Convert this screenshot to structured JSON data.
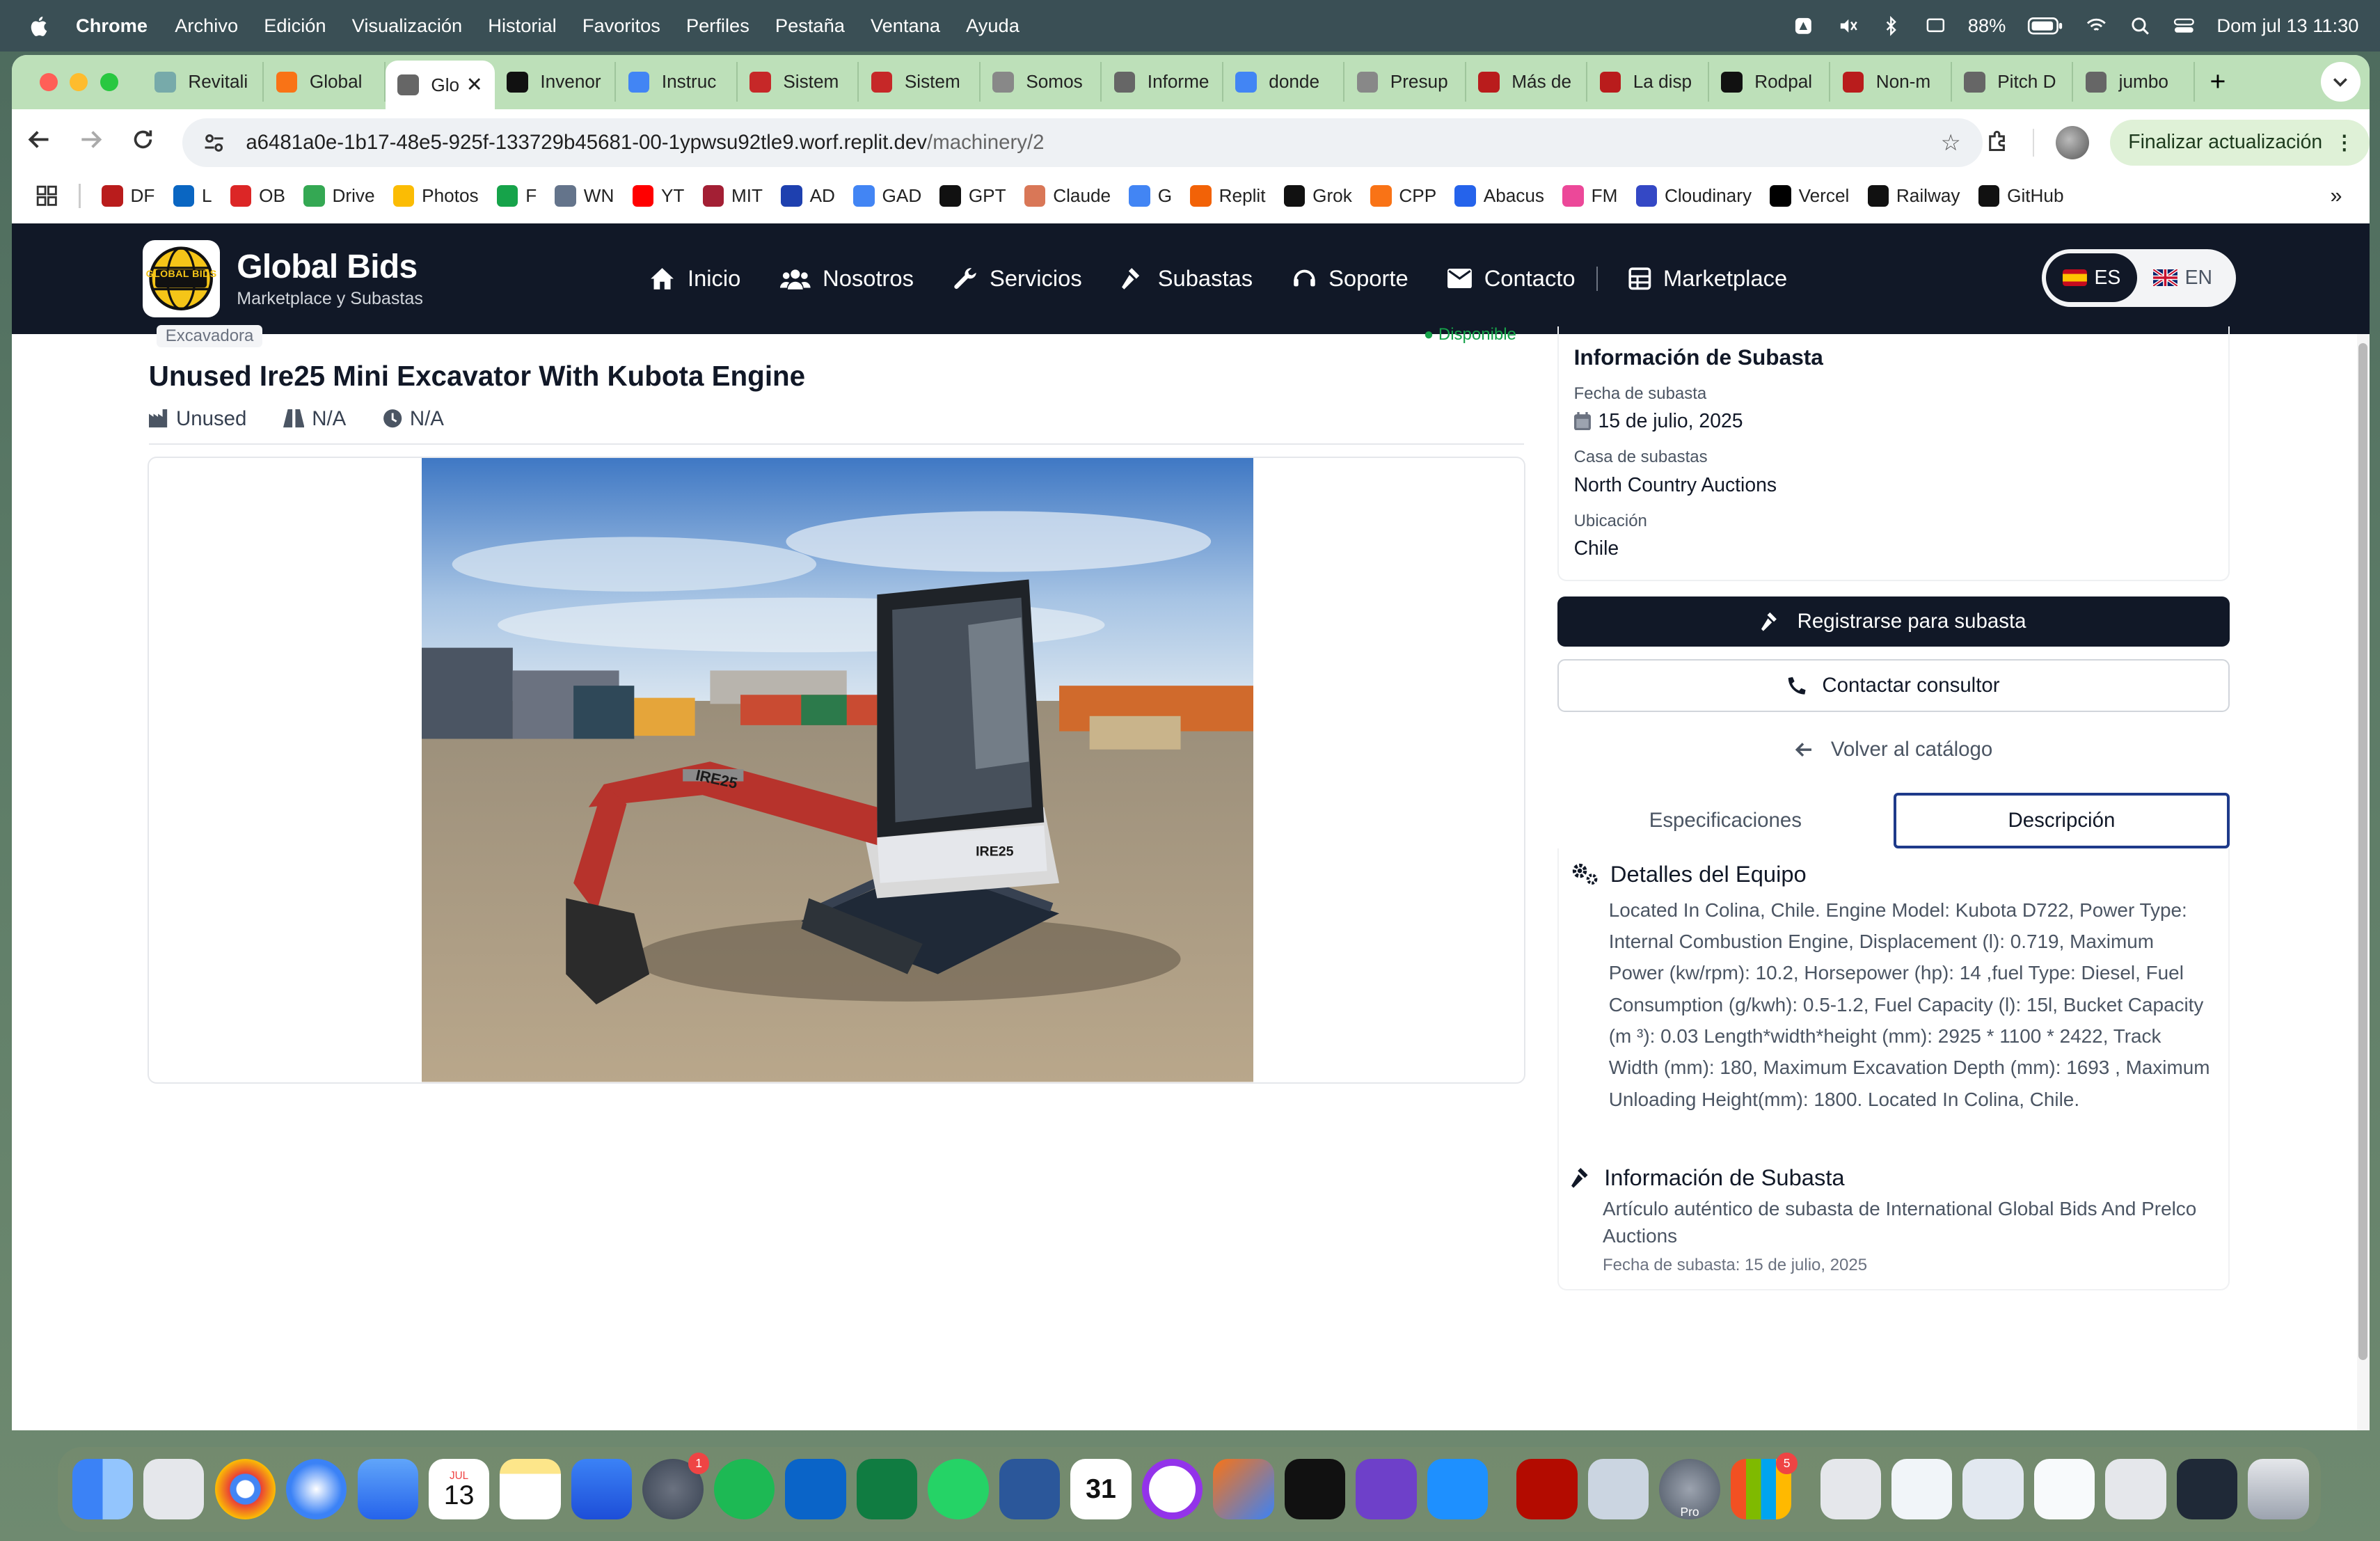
{
  "menubar": {
    "app": "Chrome",
    "items": [
      "Archivo",
      "Edición",
      "Visualización",
      "Historial",
      "Favoritos",
      "Perfiles",
      "Pestaña",
      "Ventana",
      "Ayuda"
    ],
    "battery": "88%",
    "datetime": "Dom jul 13  11:30"
  },
  "tabs": [
    {
      "label": "Revitali",
      "color": "#7aa"
    },
    {
      "label": "Global",
      "color": "#f97316"
    },
    {
      "label": "Glo",
      "color": "#666",
      "active": true
    },
    {
      "label": "Invenor",
      "color": "#111"
    },
    {
      "label": "Instruc",
      "color": "#4285f4"
    },
    {
      "label": "Sistem",
      "color": "#c62828"
    },
    {
      "label": "Sistem",
      "color": "#c62828"
    },
    {
      "label": "Somos",
      "color": "#888"
    },
    {
      "label": "Informe",
      "color": "#666"
    },
    {
      "label": "donde",
      "color": "#4285f4"
    },
    {
      "label": "Presup",
      "color": "#888"
    },
    {
      "label": "Más de",
      "color": "#b91c1c"
    },
    {
      "label": "La disp",
      "color": "#b91c1c"
    },
    {
      "label": "Rodpal",
      "color": "#111"
    },
    {
      "label": "Non-m",
      "color": "#b91c1c"
    },
    {
      "label": "Pitch D",
      "color": "#666"
    },
    {
      "label": "jumbo",
      "color": "#666"
    }
  ],
  "address": {
    "host": "a6481a0e-1b17-48e5-925f-133729b45681-00-1ypwsu92tle9.worf.replit.dev",
    "path": "/machinery/2"
  },
  "update_button": "Finalizar actualización",
  "bookmarks": [
    {
      "label": "DF",
      "color": "#b91c1c"
    },
    {
      "label": "L",
      "color": "#0a66c2"
    },
    {
      "label": "OB",
      "color": "#dc2626"
    },
    {
      "label": "Drive",
      "color": "#34a853"
    },
    {
      "label": "Photos",
      "color": "#fbbc04"
    },
    {
      "label": "F",
      "color": "#16a34a"
    },
    {
      "label": "WN",
      "color": "#64748b"
    },
    {
      "label": "YT",
      "color": "#ff0000"
    },
    {
      "label": "MIT",
      "color": "#a31f34"
    },
    {
      "label": "AD",
      "color": "#1e40af"
    },
    {
      "label": "GAD",
      "color": "#4285f4"
    },
    {
      "label": "GPT",
      "color": "#111"
    },
    {
      "label": "Claude",
      "color": "#d97757"
    },
    {
      "label": "G",
      "color": "#4285f4"
    },
    {
      "label": "Replit",
      "color": "#f26207"
    },
    {
      "label": "Grok",
      "color": "#111"
    },
    {
      "label": "CPP",
      "color": "#f97316"
    },
    {
      "label": "Abacus",
      "color": "#2563eb"
    },
    {
      "label": "FM",
      "color": "#ec4899"
    },
    {
      "label": "Cloudinary",
      "color": "#3448c5"
    },
    {
      "label": "Vercel",
      "color": "#000"
    },
    {
      "label": "Railway",
      "color": "#111"
    },
    {
      "label": "GitHub",
      "color": "#111"
    }
  ],
  "site": {
    "brand": "Global Bids",
    "tagline": "Marketplace y Subastas",
    "logo_text": "GLOBAL BIDS",
    "nav": [
      "Inicio",
      "Nosotros",
      "Servicios",
      "Subastas",
      "Soporte",
      "Contacto",
      "Marketplace"
    ],
    "lang_es": "ES",
    "lang_en": "EN"
  },
  "product": {
    "category": "Excavadora",
    "availability": "Disponible",
    "title": "Unused Ire25 Mini Excavator With Kubota Engine",
    "condition": "Unused",
    "hours": "N/A",
    "year": "N/A",
    "machine_label": "IRE25"
  },
  "auction": {
    "heading": "Información de Subasta",
    "date_label": "Fecha de subasta",
    "date": "15 de julio, 2025",
    "house_label": "Casa de subastas",
    "house": "North Country Auctions",
    "location_label": "Ubicación",
    "location": "Chile"
  },
  "actions": {
    "register": "Registrarse para subasta",
    "contact": "Contactar consultor",
    "back": "Volver al catálogo"
  },
  "detail_tabs": {
    "specs": "Especificaciones",
    "description": "Descripción"
  },
  "description": {
    "heading": "Detalles del Equipo",
    "text": "Located In Colina, Chile. Engine Model: Kubota D722, Power Type: Internal Combustion Engine, Displacement (l): 0.719, Maximum Power (kw/rpm): 10.2, Horsepower (hp): 14 ,fuel Type: Diesel, Fuel Consumption (g/kwh): 0.5-1.2, Fuel Capacity (l): 15l, Bucket Capacity (m ³): 0.03 Length*width*height (mm): 2925 * 1100 * 2422, Track Width (mm): 180, Maximum Excavation Depth (mm): 1693 , Maximum Unloading Height(mm): 1800. Located In Colina, Chile.",
    "auction_heading": "Información de Subasta",
    "auction_text": "Artículo auténtico de subasta de International Global Bids And Prelco Auctions",
    "auction_date": "Fecha de subasta: 15 de julio, 2025"
  },
  "dock": {
    "badges": {
      "settings": "1",
      "office": "5"
    },
    "calendar_month": "JUL",
    "calendar_day": "13",
    "fantastical_day": "31",
    "pro_label": "Pro"
  }
}
